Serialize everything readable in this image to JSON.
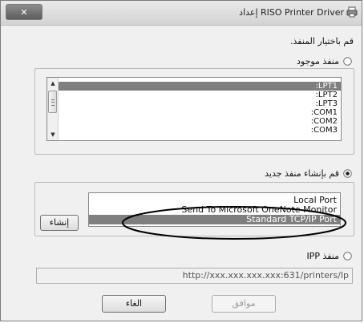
{
  "window": {
    "title": "RISO Printer Driver إعداد",
    "close_glyph": "✕",
    "icons": {
      "title": "printer-icon",
      "close": "close-icon"
    }
  },
  "instruction": "قم باختيار المنفذ.",
  "existing_port": {
    "label": "منفذ موجود",
    "selected": false,
    "ports": [
      ":LPT1",
      ":LPT2",
      ":LPT3",
      ":COM1",
      ":COM2",
      ":COM3"
    ],
    "selected_port": ":LPT1"
  },
  "new_port": {
    "label": "قم بإنشاء منفذ جديد",
    "selected": true,
    "port_types": [
      "Local Port",
      "Send To Microsoft OneNote Monitor",
      "Standard TCP/IP Port"
    ],
    "selected_type": "Standard TCP/IP Port",
    "create_button": "إنشاء",
    "highlight_color": "#000000"
  },
  "ipp_port": {
    "label": "منفذ IPP",
    "selected": false,
    "url": "http://xxx.xxx.xxx.xxx:631/printers/lp"
  },
  "buttons": {
    "ok": "موافق",
    "cancel": "الغاء"
  },
  "colors": {
    "selection": "#7f7f7f",
    "window_bg": "#f0f0f0"
  }
}
